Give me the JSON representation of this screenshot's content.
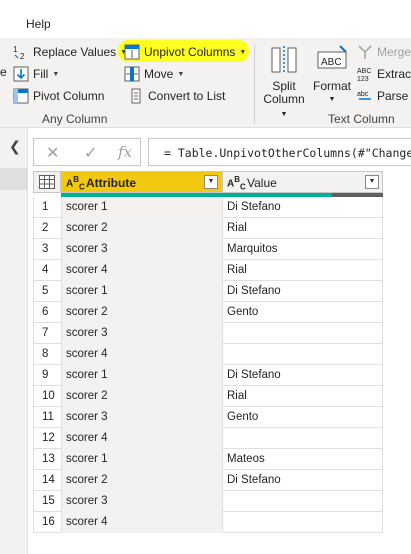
{
  "menu": {
    "help": "Help"
  },
  "ribbon": {
    "replace_values": "Replace Values",
    "fill": "Fill",
    "pivot_column": "Pivot Column",
    "unpivot_columns": "Unpivot Columns",
    "move": "Move",
    "convert_to_list": "Convert to List",
    "any_column_label": "Any Column",
    "split_column": [
      "Split",
      "Column"
    ],
    "format": "Format",
    "merge": "Merge",
    "extract": "Extract",
    "parse": "Parse",
    "text_column_label": "Text Column",
    "left_edge_label": "e",
    "highlight_color": "#ffff22"
  },
  "formula": {
    "text": "= Table.UnpivotOtherColumns(#\"Changed"
  },
  "grid": {
    "columns": [
      {
        "name": "Attribute",
        "type_icon": "abc-text-icon"
      },
      {
        "name": "Value",
        "type_icon": "abc-text-icon"
      }
    ],
    "accent_color": "#f2c811",
    "quality_color": "#00b294",
    "rows": [
      {
        "n": "1",
        "attr": "scorer 1",
        "val": "Di Stefano"
      },
      {
        "n": "2",
        "attr": "scorer 2",
        "val": "Rial"
      },
      {
        "n": "3",
        "attr": "scorer 3",
        "val": "Marquitos"
      },
      {
        "n": "4",
        "attr": "scorer 4",
        "val": "Rial"
      },
      {
        "n": "5",
        "attr": "scorer 1",
        "val": "Di Stefano"
      },
      {
        "n": "6",
        "attr": "scorer 2",
        "val": "Gento"
      },
      {
        "n": "7",
        "attr": "scorer 3",
        "val": ""
      },
      {
        "n": "8",
        "attr": "scorer 4",
        "val": ""
      },
      {
        "n": "9",
        "attr": "scorer 1",
        "val": "Di Stefano"
      },
      {
        "n": "10",
        "attr": "scorer 2",
        "val": "Rial"
      },
      {
        "n": "11",
        "attr": "scorer 3",
        "val": "Gento"
      },
      {
        "n": "12",
        "attr": "scorer 4",
        "val": ""
      },
      {
        "n": "13",
        "attr": "scorer 1",
        "val": "Mateos"
      },
      {
        "n": "14",
        "attr": "scorer 2",
        "val": "Di Stefano"
      },
      {
        "n": "15",
        "attr": "scorer 3",
        "val": ""
      },
      {
        "n": "16",
        "attr": "scorer 4",
        "val": ""
      }
    ]
  }
}
